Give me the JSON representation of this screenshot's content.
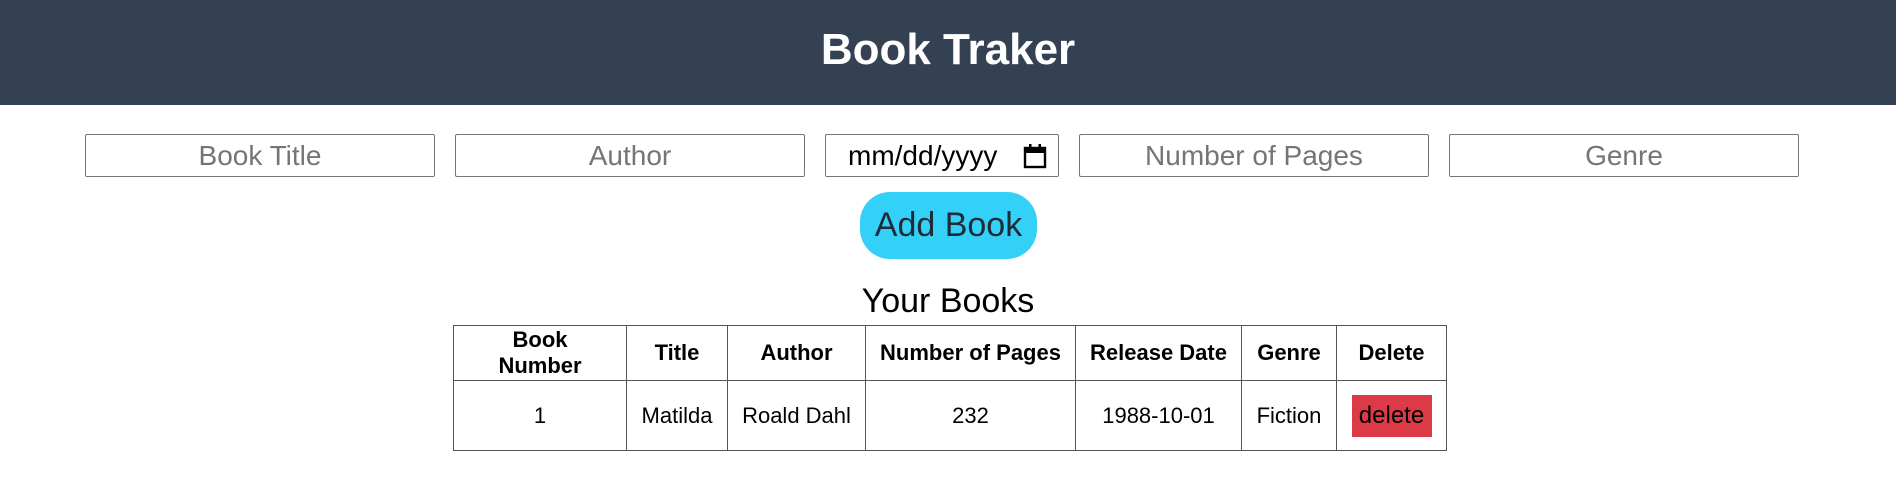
{
  "app": {
    "title": "Book Traker"
  },
  "form": {
    "book_title": {
      "placeholder": "Book Title",
      "value": ""
    },
    "author": {
      "placeholder": "Author",
      "value": ""
    },
    "release_date": {
      "display": "mm/dd/yyyy",
      "icon": "calendar-icon"
    },
    "pages": {
      "placeholder": "Number of Pages",
      "value": ""
    },
    "genre": {
      "placeholder": "Genre",
      "value": ""
    },
    "add_button_label": "Add Book"
  },
  "books": {
    "heading": "Your Books",
    "columns": [
      "Book Number",
      "Title",
      "Author",
      "Number of Pages",
      "Release Date",
      "Genre",
      "Delete"
    ],
    "rows": [
      {
        "number": "1",
        "title": "Matilda",
        "author": "Roald Dahl",
        "pages": "232",
        "release_date": "1988-10-01",
        "genre": "Fiction",
        "delete_label": "delete"
      }
    ]
  },
  "colors": {
    "header_bg": "#334152",
    "add_button": "#33d0f8",
    "delete_button": "#dc3a46"
  }
}
